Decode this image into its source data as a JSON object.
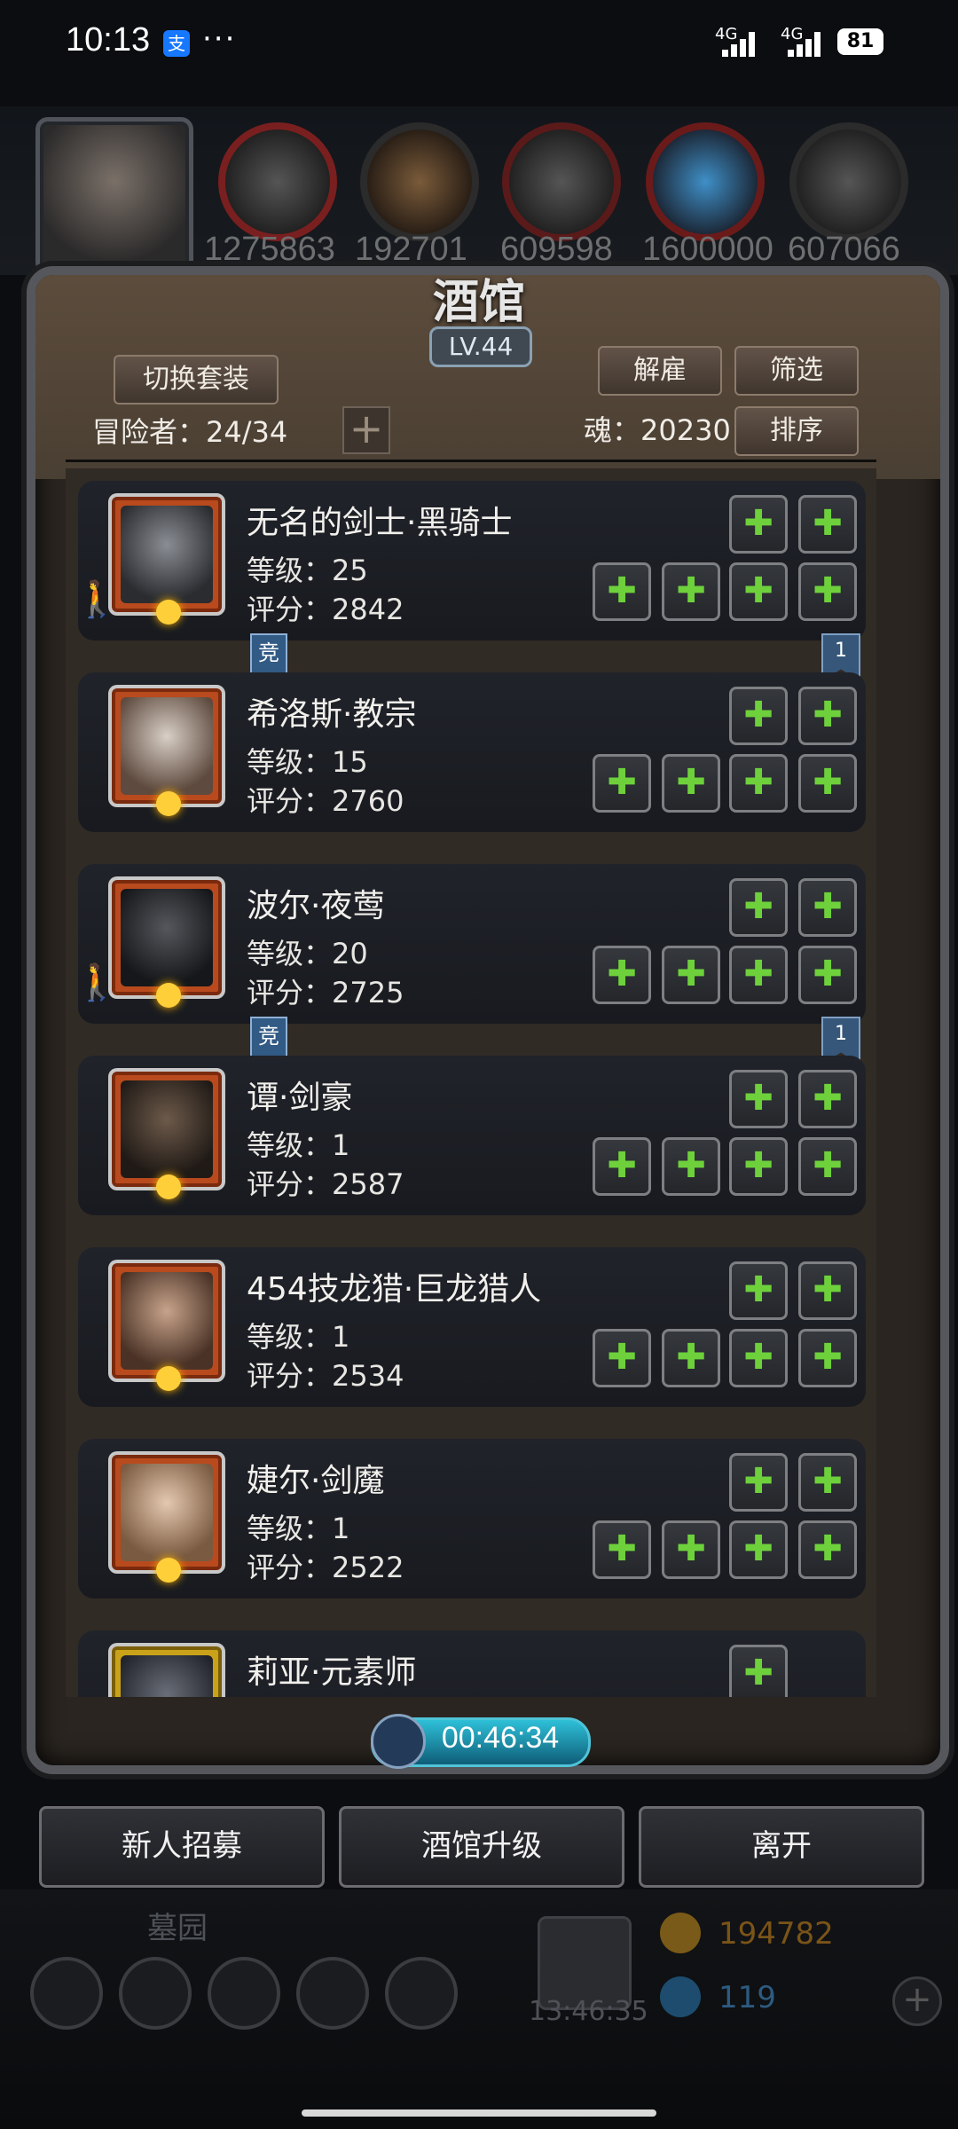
{
  "status_bar": {
    "time": "10:13",
    "app_badge": "支",
    "dots": "···",
    "net1": "4G",
    "net2": "4G",
    "battery": "81"
  },
  "resources": [
    "1275863",
    "192701",
    "609598",
    "1600000",
    "607066"
  ],
  "tavern": {
    "title": "酒馆",
    "level": "LV.44",
    "switch_outfit": "切换套装",
    "dismiss": "解雇",
    "filter": "筛选",
    "sort": "排序",
    "adventurers_label": "冒险者：24/34",
    "soul_label": "魂：20230"
  },
  "tags": {
    "compete": "竞",
    "flag_one": "1"
  },
  "characters": [
    {
      "name": "无名的剑士·黑骑士",
      "level": "等级：25",
      "score": "评分：2842"
    },
    {
      "name": "希洛斯·教宗",
      "level": "等级：15",
      "score": "评分：2760"
    },
    {
      "name": "波尔·夜莺",
      "level": "等级：20",
      "score": "评分：2725"
    },
    {
      "name": "谭·剑豪",
      "level": "等级：1",
      "score": "评分：2587"
    },
    {
      "name": "454技龙猎·巨龙猎人",
      "level": "等级：1",
      "score": "评分：2534"
    },
    {
      "name": "婕尔·剑魔",
      "level": "等级：1",
      "score": "评分：2522"
    },
    {
      "name": "莉亚·元素师",
      "level": "",
      "score": ""
    }
  ],
  "timer": "00:46:34",
  "bottom_buttons": {
    "recruit": "新人招募",
    "upgrade": "酒馆升级",
    "leave": "离开"
  },
  "background": {
    "graveyard": "墓园",
    "gold": "194782",
    "gems": "119",
    "gift_timer": "13:46:35"
  }
}
